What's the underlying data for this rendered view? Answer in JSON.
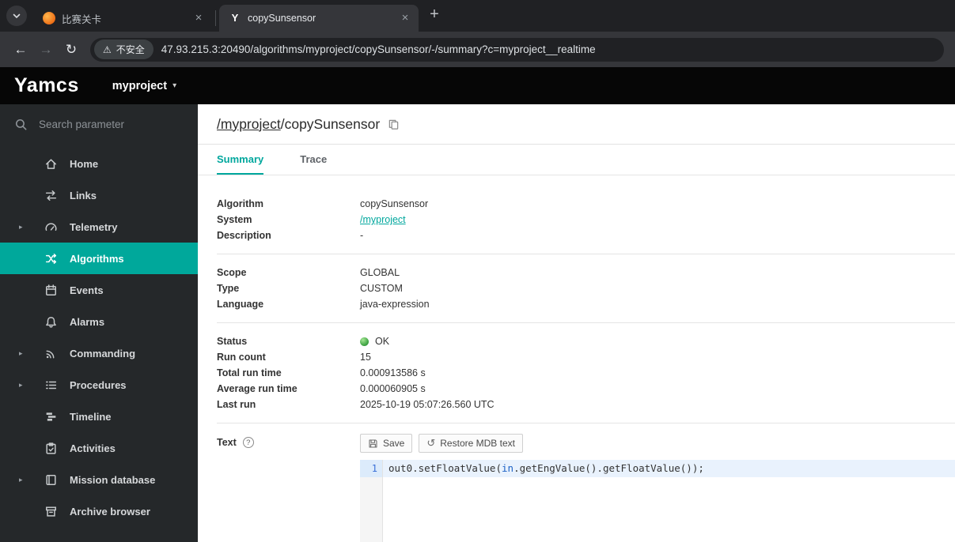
{
  "browser": {
    "tabs": [
      {
        "title": "比赛关卡"
      },
      {
        "title": "copySunsensor"
      }
    ],
    "security_label": "不安全",
    "url": "47.93.215.3:20490/algorithms/myproject/copySunsensor/-/summary?c=myproject__realtime"
  },
  "icons": {
    "back": "←",
    "forward": "→",
    "reload": "↻",
    "warning": "⚠",
    "close": "×",
    "new_tab": "+",
    "caret_down": "▾",
    "expander": "▸",
    "undo": "↺",
    "help": "?",
    "yamcs_mark": "Y"
  },
  "app_header": {
    "logo": "Yamcs",
    "instance": "myproject"
  },
  "sidebar": {
    "search_placeholder": "Search parameter",
    "items": [
      {
        "label": "Home"
      },
      {
        "label": "Links"
      },
      {
        "label": "Telemetry"
      },
      {
        "label": "Algorithms"
      },
      {
        "label": "Events"
      },
      {
        "label": "Alarms"
      },
      {
        "label": "Commanding"
      },
      {
        "label": "Procedures"
      },
      {
        "label": "Timeline"
      },
      {
        "label": "Activities"
      },
      {
        "label": "Mission database"
      },
      {
        "label": "Archive browser"
      }
    ]
  },
  "main": {
    "title": {
      "system": "/myproject",
      "name": "/copySunsensor"
    },
    "tabs": [
      {
        "label": "Summary"
      },
      {
        "label": "Trace"
      }
    ],
    "details": {
      "s1": [
        {
          "label": "Algorithm",
          "value": "copySunsensor"
        },
        {
          "label": "System",
          "value": "/myproject"
        },
        {
          "label": "Description",
          "value": "-"
        }
      ],
      "s2": [
        {
          "label": "Scope",
          "value": "GLOBAL"
        },
        {
          "label": "Type",
          "value": "CUSTOM"
        },
        {
          "label": "Language",
          "value": "java-expression"
        }
      ],
      "s3": [
        {
          "label": "Status",
          "value": "OK"
        },
        {
          "label": "Run count",
          "value": "15"
        },
        {
          "label": "Total run time",
          "value": "0.000913586 s"
        },
        {
          "label": "Average run time",
          "value": "0.000060905 s"
        },
        {
          "label": "Last run",
          "value": "2025-10-19 05:07:26.560 UTC"
        }
      ]
    },
    "text_section": {
      "label": "Text",
      "save": "Save",
      "restore": "Restore MDB text",
      "line_number": "1",
      "code_tokens": [
        "out0.setFloatValue(",
        "in",
        ".getEngValue().getFloatValue());"
      ]
    }
  },
  "colors": {
    "accent": "#00a79d",
    "selected_nav": "#00a89b",
    "status_ok": "#3fa344"
  }
}
